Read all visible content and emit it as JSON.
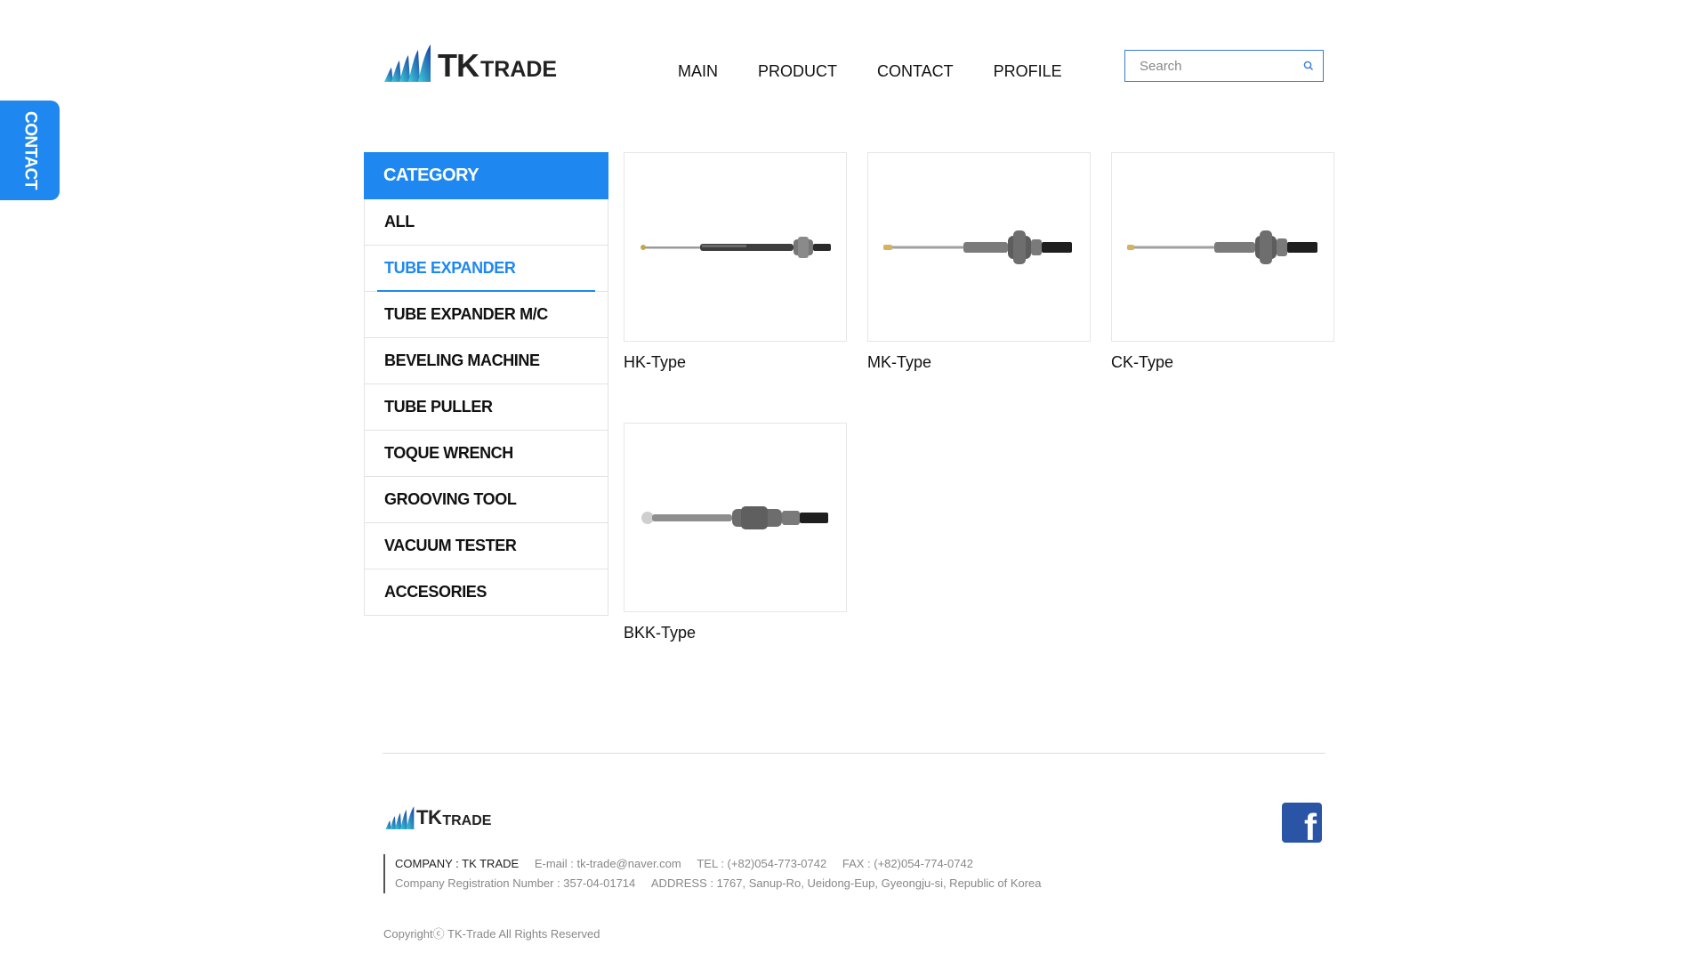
{
  "side_tab": {
    "label": "CONTACT"
  },
  "header": {
    "logo_main": "TK",
    "logo_sub": "TRADE",
    "nav": [
      "MAIN",
      "PRODUCT",
      "CONTACT",
      "PROFILE"
    ],
    "search_placeholder": "Search"
  },
  "category": {
    "title": "CATEGORY",
    "items": [
      "ALL",
      "TUBE EXPANDER",
      "TUBE EXPANDER M/C",
      "BEVELING MACHINE",
      "TUBE PULLER",
      "TOQUE WRENCH",
      "GROOVING TOOL",
      "VACUUM TESTER",
      "ACCESORIES"
    ],
    "active": "TUBE EXPANDER"
  },
  "products": [
    "HK-Type",
    "MK-Type",
    "CK-Type",
    "BKK-Type"
  ],
  "footer": {
    "logo_main": "TK",
    "logo_sub": "TRADE",
    "company": "COMPANY : TK TRADE",
    "email": "E-mail : tk-trade@naver.com",
    "tel": "TEL : (+82)054-773-0742",
    "fax": "FAX : (+82)054-774-0742",
    "registration": "Company Registration Number : 357-04-01714",
    "address": "ADDRESS : 1767, Sanup-Ro, Ueidong-Eup, Gyeongju-si, Republic of Korea",
    "copyright": "Copyrightⓒ TK-Trade All Rights Reserved",
    "social_icon": "facebook-icon"
  },
  "colors": {
    "accent": "#1e88f0",
    "facebook": "#2a55a6"
  }
}
